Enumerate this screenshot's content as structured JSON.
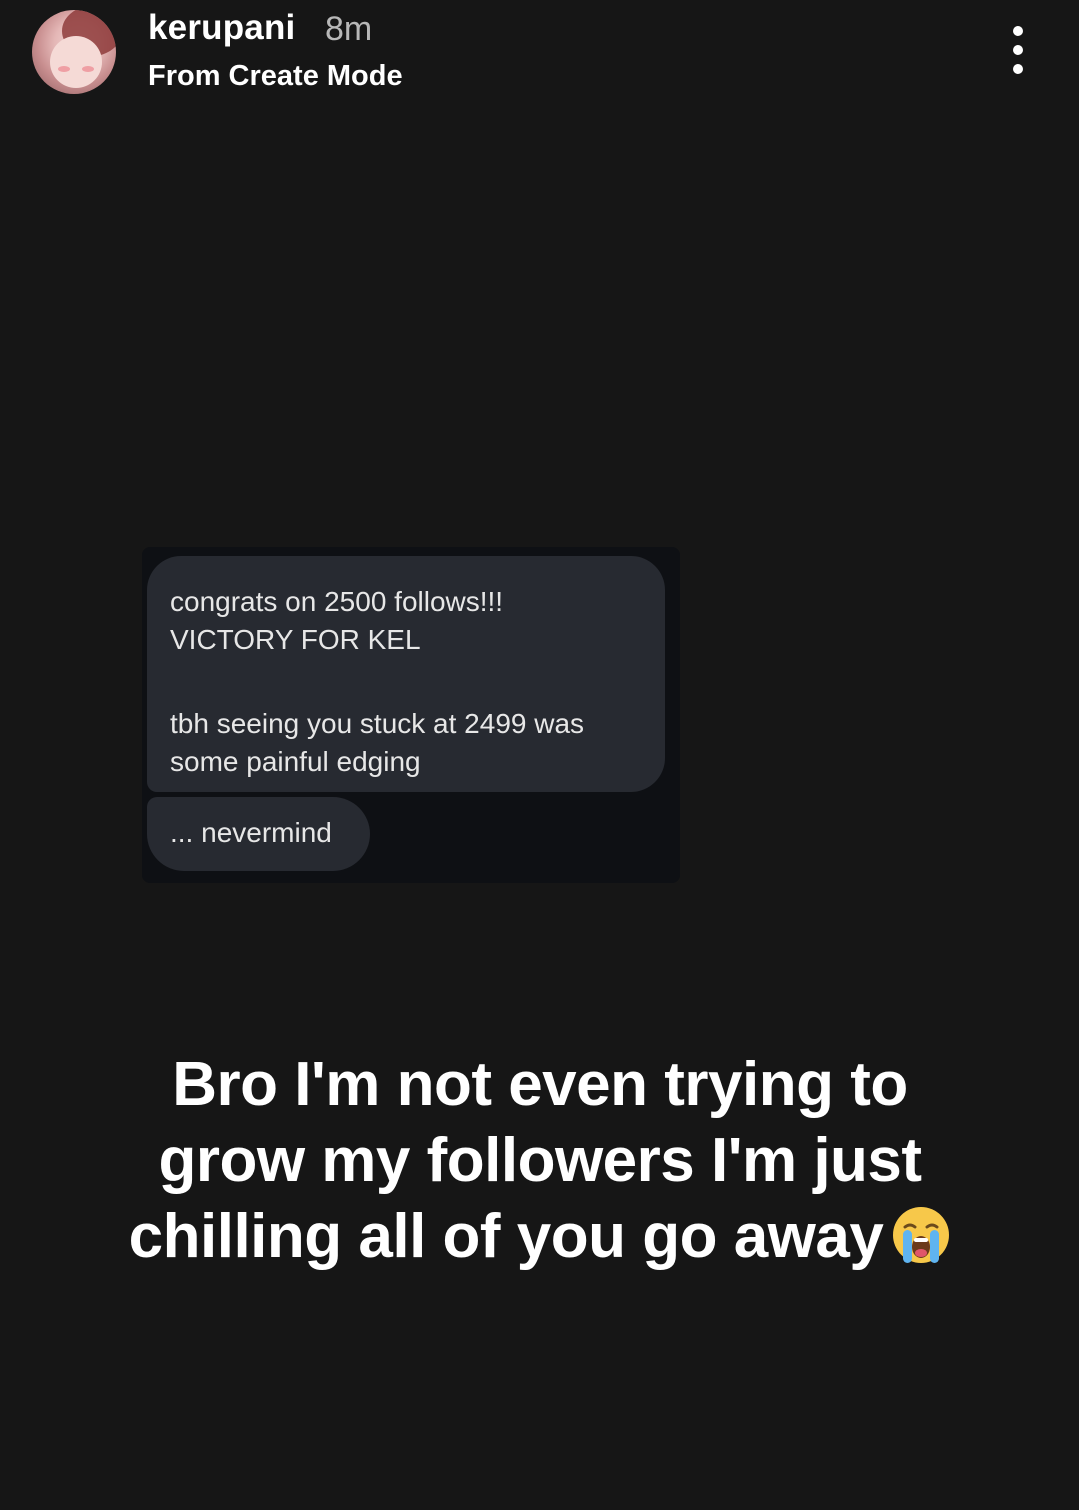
{
  "header": {
    "username": "kerupani",
    "time": "8m",
    "subtitle": "From Create Mode"
  },
  "dm": {
    "message_lines": [
      "congrats on 2500 follows!!!",
      "VICTORY FOR KEL",
      "tbh seeing you stuck at 2499 was",
      "some painful edging"
    ],
    "followup": "... nevermind"
  },
  "caption": {
    "lines": [
      "Bro I'm not even trying to",
      "grow my followers I'm just",
      "chilling all of you go away"
    ],
    "emoji": "loudly-crying-face-icon"
  },
  "colors": {
    "background": "#161616",
    "bubble": "#272a31",
    "card": "#0e1014"
  }
}
